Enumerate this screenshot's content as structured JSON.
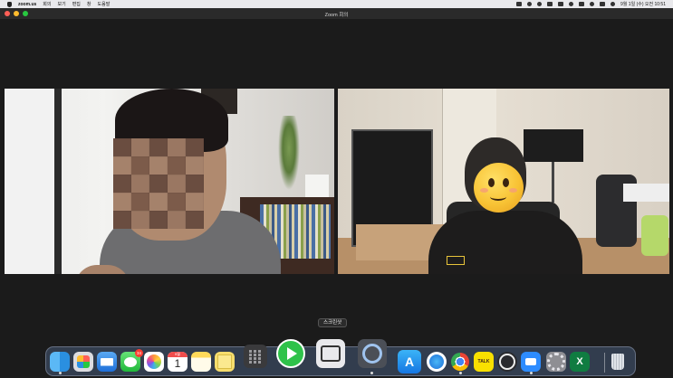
{
  "menubar": {
    "app_name": "zoom.us",
    "menus": [
      "회의",
      "보기",
      "편집",
      "창",
      "도움말"
    ],
    "clock": "9월 1일 (수) 오전 10:51"
  },
  "window": {
    "title": "Zoom 회의"
  },
  "tooltip": {
    "text": "스크린샷"
  },
  "dock": {
    "items": [
      {
        "name": "Finder"
      },
      {
        "name": "Launchpad"
      },
      {
        "name": "Mail"
      },
      {
        "name": "Messages",
        "badge": "34"
      },
      {
        "name": "Photos"
      },
      {
        "name": "Calendar",
        "month": "9월",
        "day": "1"
      },
      {
        "name": "Notes"
      },
      {
        "name": "Stickies"
      },
      {
        "name": "Calculator"
      },
      {
        "name": "Play"
      },
      {
        "name": "Screenshot"
      },
      {
        "name": "QuickTime Player"
      },
      {
        "name": "App Store",
        "glyph": "A"
      },
      {
        "name": "Safari"
      },
      {
        "name": "Chrome"
      },
      {
        "name": "KakaoTalk",
        "glyph": "TALK"
      },
      {
        "name": "OBS"
      },
      {
        "name": "Zoom"
      },
      {
        "name": "System Preferences"
      },
      {
        "name": "Excel",
        "glyph": "X"
      },
      {
        "name": "Trash"
      }
    ]
  }
}
